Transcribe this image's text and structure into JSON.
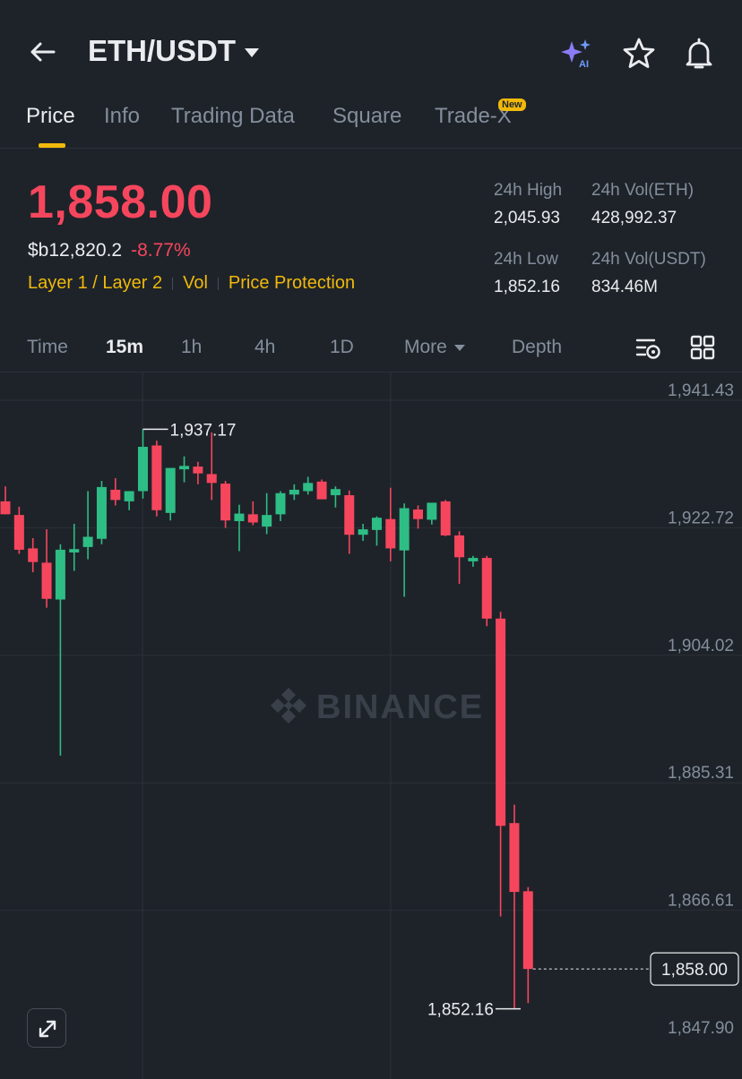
{
  "header": {
    "pair": "ETH/USDT"
  },
  "tabs": [
    {
      "label": "Price",
      "active": true
    },
    {
      "label": "Info",
      "active": false
    },
    {
      "label": "Trading Data",
      "active": false
    },
    {
      "label": "Square",
      "active": false
    },
    {
      "label": "Trade-X",
      "active": false
    }
  ],
  "new_badge": "New",
  "price": {
    "last": "1,858.00",
    "fiat": "$b12,820.2",
    "change": "-8.77%"
  },
  "tags": [
    "Layer 1 / Layer 2",
    "Vol",
    "Price Protection"
  ],
  "stats": {
    "high_label": "24h High",
    "high_value": "2,045.93",
    "vol_eth_label": "24h Vol(ETH)",
    "vol_eth_value": "428,992.37",
    "low_label": "24h Low",
    "low_value": "1,852.16",
    "vol_usdt_label": "24h Vol(USDT)",
    "vol_usdt_value": "834.46M"
  },
  "intervals": {
    "time": "Time",
    "m15": "15m",
    "h1": "1h",
    "h4": "4h",
    "d1": "1D",
    "more": "More",
    "depth": "Depth",
    "active": "15m"
  },
  "colors": {
    "up": "#2ebd85",
    "down": "#f6465d",
    "accent": "#f0b90b",
    "background": "#1e2329"
  },
  "icons": [
    "back-arrow-icon",
    "ai-sparkle-icon",
    "star-icon",
    "bell-icon",
    "chart-settings-icon",
    "grid-layout-icon",
    "expand-icon",
    "binance-logo-icon"
  ],
  "chart_data": {
    "type": "candlestick",
    "title": "",
    "ylabel": "",
    "ylim": [
      1847.9,
      1941.43
    ],
    "y_ticks": [
      "1,941.43",
      "1,922.72",
      "1,904.02",
      "1,885.31",
      "1,866.61",
      "1,847.90"
    ],
    "y_tick_values": [
      1941.43,
      1922.72,
      1904.02,
      1885.31,
      1866.61,
      1847.9
    ],
    "watermark": "BINANCE",
    "last_price_label": "1,858.00",
    "last_price": 1858.0,
    "high_marker": {
      "label": "1,937.17",
      "value": 1937.17,
      "index": 10
    },
    "low_marker": {
      "label": "1,852.16",
      "value": 1852.16,
      "index": 37
    },
    "candles": [
      {
        "o": 1926.6,
        "h": 1928.8,
        "l": 1924.7,
        "c": 1924.7
      },
      {
        "o": 1924.6,
        "h": 1925.8,
        "l": 1918.9,
        "c": 1919.5
      },
      {
        "o": 1919.7,
        "h": 1921.2,
        "l": 1916.2,
        "c": 1917.7
      },
      {
        "o": 1917.6,
        "h": 1922.5,
        "l": 1911.0,
        "c": 1912.3
      },
      {
        "o": 1912.2,
        "h": 1920.3,
        "l": 1889.3,
        "c": 1919.5
      },
      {
        "o": 1919.1,
        "h": 1923.3,
        "l": 1916.4,
        "c": 1919.6
      },
      {
        "o": 1919.9,
        "h": 1928.1,
        "l": 1918.1,
        "c": 1921.4
      },
      {
        "o": 1921.1,
        "h": 1929.6,
        "l": 1920.3,
        "c": 1928.7
      },
      {
        "o": 1928.3,
        "h": 1930.0,
        "l": 1926.0,
        "c": 1926.8
      },
      {
        "o": 1926.6,
        "h": 1928.1,
        "l": 1925.3,
        "c": 1928.1
      },
      {
        "o": 1928.1,
        "h": 1937.17,
        "l": 1927.0,
        "c": 1934.6
      },
      {
        "o": 1934.8,
        "h": 1935.5,
        "l": 1924.4,
        "c": 1925.3
      },
      {
        "o": 1924.9,
        "h": 1931.5,
        "l": 1923.8,
        "c": 1931.5
      },
      {
        "o": 1931.3,
        "h": 1933.2,
        "l": 1929.4,
        "c": 1931.8
      },
      {
        "o": 1931.7,
        "h": 1932.4,
        "l": 1929.1,
        "c": 1930.7
      },
      {
        "o": 1930.6,
        "h": 1936.7,
        "l": 1926.8,
        "c": 1929.3
      },
      {
        "o": 1929.2,
        "h": 1929.6,
        "l": 1922.7,
        "c": 1923.8
      },
      {
        "o": 1923.7,
        "h": 1926.1,
        "l": 1919.3,
        "c": 1924.8
      },
      {
        "o": 1924.7,
        "h": 1926.6,
        "l": 1923.1,
        "c": 1923.5
      },
      {
        "o": 1922.9,
        "h": 1927.8,
        "l": 1921.8,
        "c": 1924.6
      },
      {
        "o": 1924.7,
        "h": 1928.1,
        "l": 1923.7,
        "c": 1927.8
      },
      {
        "o": 1927.6,
        "h": 1929.1,
        "l": 1926.8,
        "c": 1928.3
      },
      {
        "o": 1928.1,
        "h": 1930.2,
        "l": 1927.6,
        "c": 1929.3
      },
      {
        "o": 1929.5,
        "h": 1929.8,
        "l": 1927.1,
        "c": 1926.9
      },
      {
        "o": 1927.5,
        "h": 1928.8,
        "l": 1925.7,
        "c": 1928.4
      },
      {
        "o": 1927.5,
        "h": 1928.2,
        "l": 1918.9,
        "c": 1921.7
      },
      {
        "o": 1921.7,
        "h": 1923.3,
        "l": 1920.8,
        "c": 1922.5
      },
      {
        "o": 1922.4,
        "h": 1924.4,
        "l": 1920.1,
        "c": 1924.2
      },
      {
        "o": 1924.0,
        "h": 1928.6,
        "l": 1917.8,
        "c": 1919.7
      },
      {
        "o": 1919.4,
        "h": 1926.3,
        "l": 1912.6,
        "c": 1925.6
      },
      {
        "o": 1925.4,
        "h": 1926.0,
        "l": 1922.6,
        "c": 1924.0
      },
      {
        "o": 1923.9,
        "h": 1926.3,
        "l": 1923.2,
        "c": 1926.4
      },
      {
        "o": 1926.6,
        "h": 1926.8,
        "l": 1921.5,
        "c": 1921.6
      },
      {
        "o": 1921.6,
        "h": 1922.2,
        "l": 1914.5,
        "c": 1918.4
      },
      {
        "o": 1917.8,
        "h": 1918.6,
        "l": 1917.0,
        "c": 1918.3
      },
      {
        "o": 1918.3,
        "h": 1918.6,
        "l": 1908.3,
        "c": 1909.4
      },
      {
        "o": 1909.4,
        "h": 1910.4,
        "l": 1865.7,
        "c": 1879.0
      },
      {
        "o": 1879.4,
        "h": 1882.1,
        "l": 1852.16,
        "c": 1869.3
      },
      {
        "o": 1869.4,
        "h": 1870.0,
        "l": 1853.0,
        "c": 1858.0
      }
    ]
  }
}
